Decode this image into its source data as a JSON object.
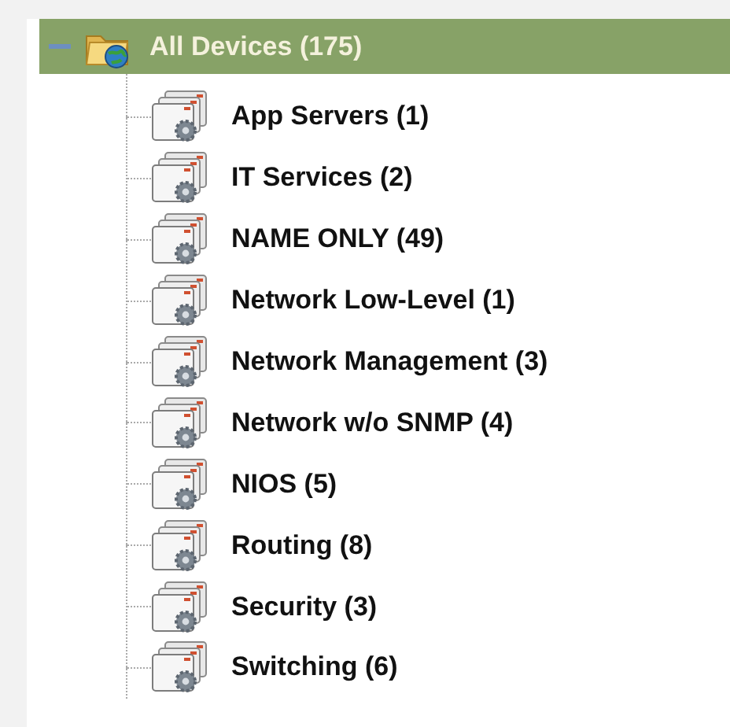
{
  "tree": {
    "label": "All Devices (175)",
    "expanded": true,
    "selected": true,
    "children": [
      {
        "label": "App Servers (1)",
        "selected": false
      },
      {
        "label": "IT Services (2)",
        "selected": false
      },
      {
        "label": "NAME ONLY (49)",
        "selected": false
      },
      {
        "label": "Network Low-Level (1)",
        "selected": false
      },
      {
        "label": "Network Management (3)",
        "selected": false
      },
      {
        "label": "Network w/o SNMP (4)",
        "selected": false
      },
      {
        "label": "NIOS (5)",
        "selected": false
      },
      {
        "label": "Routing (8)",
        "selected": false
      },
      {
        "label": "Security (3)",
        "selected": false
      },
      {
        "label": "Switching (6)",
        "selected": false
      }
    ]
  }
}
